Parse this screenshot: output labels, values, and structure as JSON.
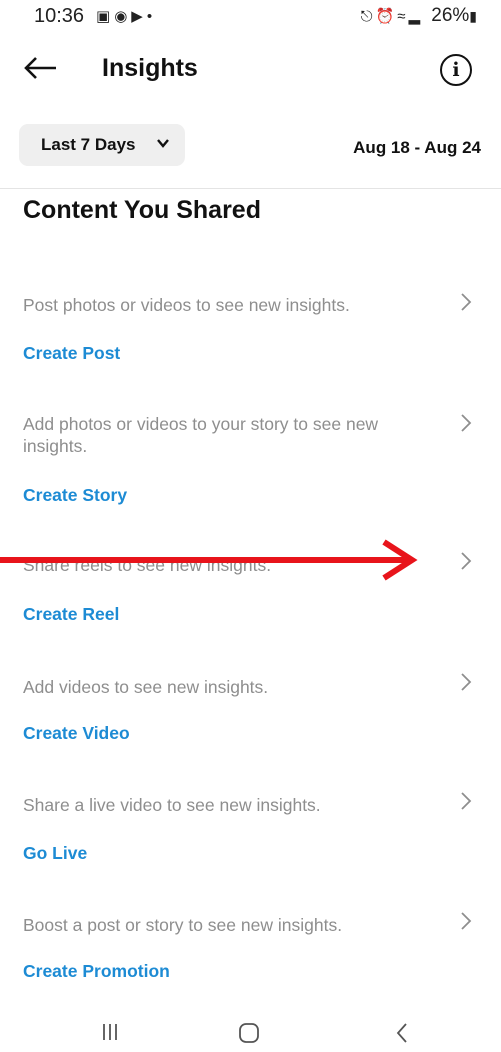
{
  "status_bar": {
    "time": "10:36",
    "left_icons": [
      "gallery-icon",
      "messenger-icon",
      "youtube-icon",
      "dot-icon"
    ],
    "right_icons": [
      "vpn-key-icon",
      "alarm-icon",
      "wifi-icon",
      "signal-icon"
    ],
    "battery": "26%"
  },
  "header": {
    "title": "Insights",
    "back_icon": "arrow-left-icon",
    "info_icon": "info-icon",
    "info_glyph": "i"
  },
  "filter": {
    "period_label": "Last 7 Days",
    "date_range": "Aug 18 - Aug 24"
  },
  "section": {
    "title": "Content You Shared",
    "rows": [
      {
        "text": "Post photos or videos to see new insights.",
        "action": "Create Post"
      },
      {
        "text": "Add photos or videos to your story to see new insights.",
        "action": "Create Story"
      },
      {
        "text": "Share reels to see new insights.",
        "action": "Create Reel"
      },
      {
        "text": "Add videos to see new insights.",
        "action": "Create Video"
      },
      {
        "text": "Share a live video to see new insights.",
        "action": "Go Live"
      },
      {
        "text": "Boost a post or story to see new insights.",
        "action": "Create Promotion"
      }
    ]
  },
  "annotation": {
    "color": "#e8141b",
    "icon": "red-arrow-icon"
  },
  "colors": {
    "accent": "#1d8bd4",
    "muted_text": "#8e8e8e"
  },
  "nav_bar": [
    "recent-apps-icon",
    "home-icon",
    "back-icon"
  ]
}
